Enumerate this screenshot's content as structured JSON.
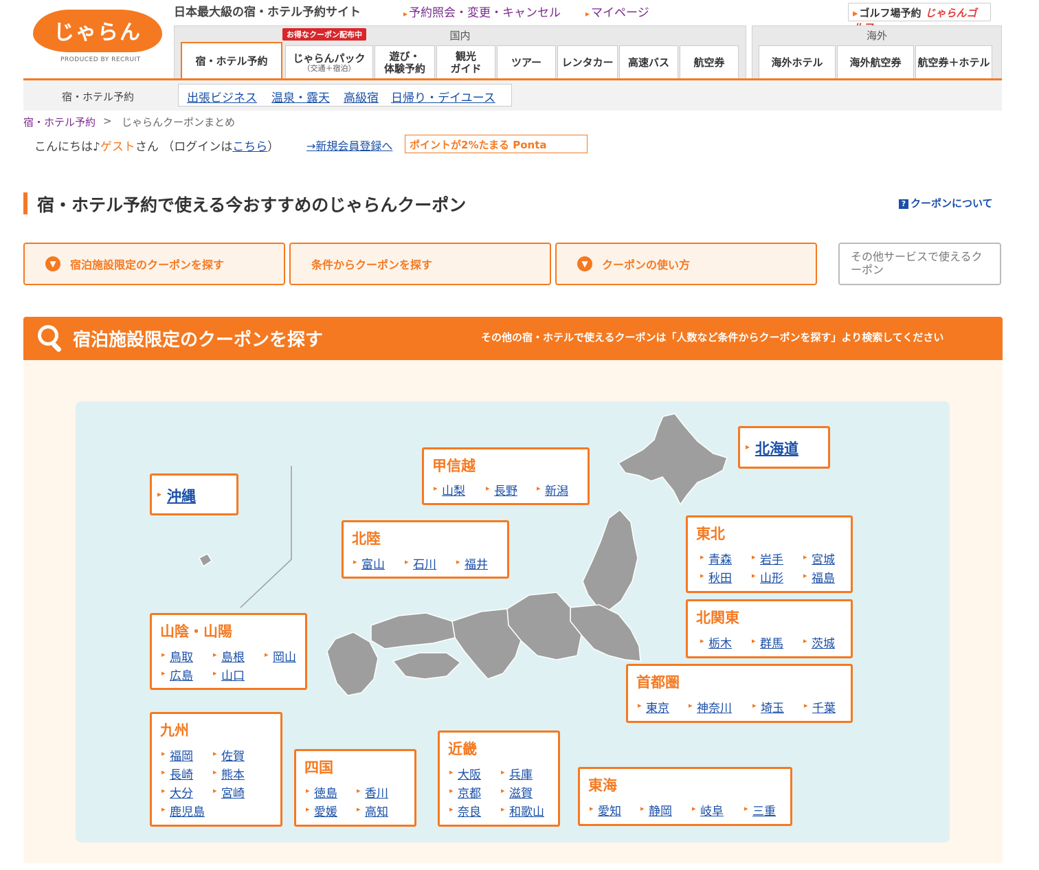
{
  "header": {
    "logo_text": "じゃらん",
    "logo_sub": "PRODUCED BY RECRUIT",
    "tagline": "日本最大級の宿・ホテル予約サイト",
    "link_reservation": "予約照会・変更・キャンセル",
    "link_mypage": "マイページ",
    "golf_label": "ゴルフ場予約",
    "golf_brand": "じゃらんゴルフ",
    "domestic_label": "国内",
    "overseas_label": "海外",
    "coupon_flag": "お得なクーポン配布中",
    "tabs_domestic": [
      {
        "label": "宿・ホテル予約",
        "sub": ""
      },
      {
        "label": "じゃらんパック",
        "sub": "（交通＋宿泊）"
      },
      {
        "label": "遊び・",
        "sub": "体験予約"
      },
      {
        "label": "観光",
        "sub": "ガイド"
      },
      {
        "label": "ツアー",
        "sub": ""
      },
      {
        "label": "レンタカー",
        "sub": ""
      },
      {
        "label": "高速バス",
        "sub": ""
      },
      {
        "label": "航空券",
        "sub": ""
      }
    ],
    "tabs_overseas": [
      "海外ホテル",
      "海外航空券",
      "航空券＋ホテル"
    ],
    "subnav_label": "宿・ホテル予約",
    "subnav_links": [
      "出張ビジネス",
      "温泉・露天",
      "高級宿",
      "日帰り・デイユース"
    ]
  },
  "breadcrumb": {
    "home": "宿・ホテル予約",
    "sep": ">",
    "current": "じゃらんクーポンまとめ"
  },
  "greeting": {
    "hello": "こんにちは♪",
    "guest": "ゲスト",
    "san": "さん",
    "login_prefix": "（ログインは",
    "login_link": "こちら",
    "login_suffix": "）"
  },
  "register_link": "→新規会員登録へ",
  "ponta_banner": "ポイントが2%たまる Ponta",
  "page_title": "宿・ホテル予約で使える今おすすめのじゃらんクーポン",
  "about_link": "クーポンについて",
  "buttons": [
    "宿泊施設限定のクーポンを探す",
    "条件からクーポンを探す",
    "クーポンの使い方"
  ],
  "button_other": "その他サービスで使えるクーポン",
  "section": {
    "title": "宿泊施設限定のクーポンを探す",
    "note": "その他の宿・ホテルで使えるクーポンは「人数など条件からクーポンを探す」より検索してください"
  },
  "regions": {
    "hokkaido": {
      "name": "北海道"
    },
    "okinawa": {
      "name": "沖縄"
    },
    "koshinetsu": {
      "name": "甲信越",
      "prefs": [
        "山梨",
        "長野",
        "新潟"
      ]
    },
    "hokuriku": {
      "name": "北陸",
      "prefs": [
        "富山",
        "石川",
        "福井"
      ]
    },
    "tohoku": {
      "name": "東北",
      "prefs": [
        "青森",
        "岩手",
        "宮城",
        "秋田",
        "山形",
        "福島"
      ]
    },
    "kitakanto": {
      "name": "北関東",
      "prefs": [
        "栃木",
        "群馬",
        "茨城"
      ]
    },
    "shutoken": {
      "name": "首都圏",
      "prefs": [
        "東京",
        "神奈川",
        "埼玉",
        "千葉"
      ]
    },
    "sanin": {
      "name": "山陰・山陽",
      "prefs": [
        "鳥取",
        "島根",
        "岡山",
        "広島",
        "山口"
      ]
    },
    "kyushu": {
      "name": "九州",
      "prefs": [
        "福岡",
        "佐賀",
        "長崎",
        "熊本",
        "大分",
        "宮崎",
        "鹿児島"
      ]
    },
    "shikoku": {
      "name": "四国",
      "prefs": [
        "徳島",
        "香川",
        "愛媛",
        "高知"
      ]
    },
    "kinki": {
      "name": "近畿",
      "prefs": [
        "大阪",
        "兵庫",
        "京都",
        "滋賀",
        "奈良",
        "和歌山"
      ]
    },
    "tokai": {
      "name": "東海",
      "prefs": [
        "愛知",
        "静岡",
        "岐阜",
        "三重"
      ]
    }
  },
  "colors": {
    "accent": "#f47920",
    "link": "#1a4fa8",
    "map": "#9e9e9e",
    "map_bg": "#dff1f2"
  }
}
